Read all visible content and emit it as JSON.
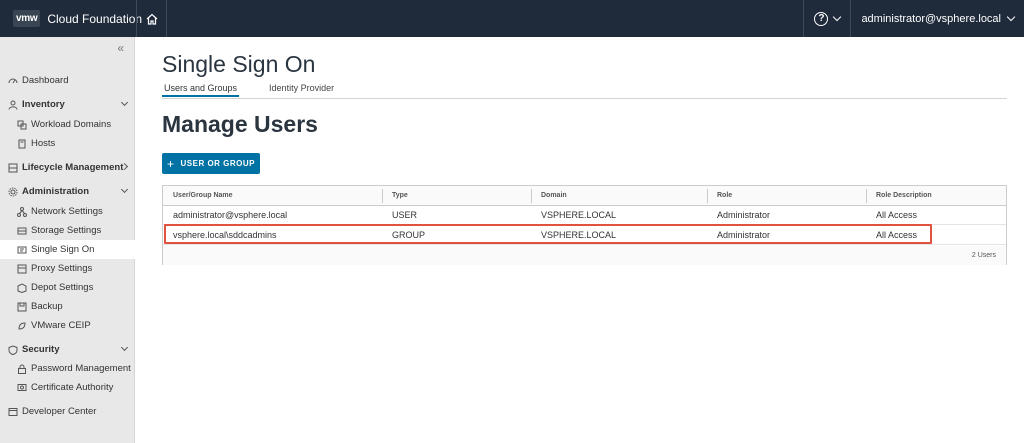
{
  "header": {
    "logo_text": "vmw",
    "app_name": "Cloud Foundation",
    "help_label": "?",
    "user_name": "administrator@vsphere.local"
  },
  "sidebar": {
    "collapse_label": "«",
    "items": [
      {
        "label": "Dashboard",
        "icon": "dashboard-icon"
      },
      {
        "label": "Inventory",
        "icon": "inventory-icon"
      },
      {
        "label": "Workload Domains",
        "icon": "workload-domains-icon"
      },
      {
        "label": "Hosts",
        "icon": "hosts-icon"
      },
      {
        "label": "Lifecycle Management",
        "icon": "lifecycle-icon"
      },
      {
        "label": "Administration",
        "icon": "administration-icon"
      },
      {
        "label": "Network Settings",
        "icon": "network-icon"
      },
      {
        "label": "Storage Settings",
        "icon": "storage-icon"
      },
      {
        "label": "Single Sign On",
        "icon": "sso-icon"
      },
      {
        "label": "Proxy Settings",
        "icon": "proxy-icon"
      },
      {
        "label": "Depot Settings",
        "icon": "depot-icon"
      },
      {
        "label": "Backup",
        "icon": "backup-icon"
      },
      {
        "label": "VMware CEIP",
        "icon": "ceip-icon"
      },
      {
        "label": "Security",
        "icon": "security-icon"
      },
      {
        "label": "Password Management",
        "icon": "password-icon"
      },
      {
        "label": "Certificate Authority",
        "icon": "certificate-icon"
      },
      {
        "label": "Developer Center",
        "icon": "developer-icon"
      }
    ]
  },
  "main": {
    "page_title": "Single Sign On",
    "tabs": [
      {
        "label": "Users and Groups",
        "active": true
      },
      {
        "label": "Identity Provider",
        "active": false
      }
    ],
    "section_title": "Manage Users",
    "add_button_label": "USER OR GROUP",
    "add_button_icon": "+",
    "grid": {
      "columns": [
        "User/Group Name",
        "Type",
        "Domain",
        "Role",
        "Role Description"
      ],
      "rows": [
        [
          "administrator@vsphere.local",
          "USER",
          "VSPHERE.LOCAL",
          "Administrator",
          "All Access"
        ],
        [
          "vsphere.local\\sddcadmins",
          "GROUP",
          "VSPHERE.LOCAL",
          "Administrator",
          "All Access"
        ]
      ],
      "footer": "2 Users"
    }
  },
  "colors": {
    "header_bg": "#1f2b3b",
    "sidebar_bg": "#e8e8e8",
    "primary": "#0072a3",
    "highlight": "#e0533f"
  }
}
